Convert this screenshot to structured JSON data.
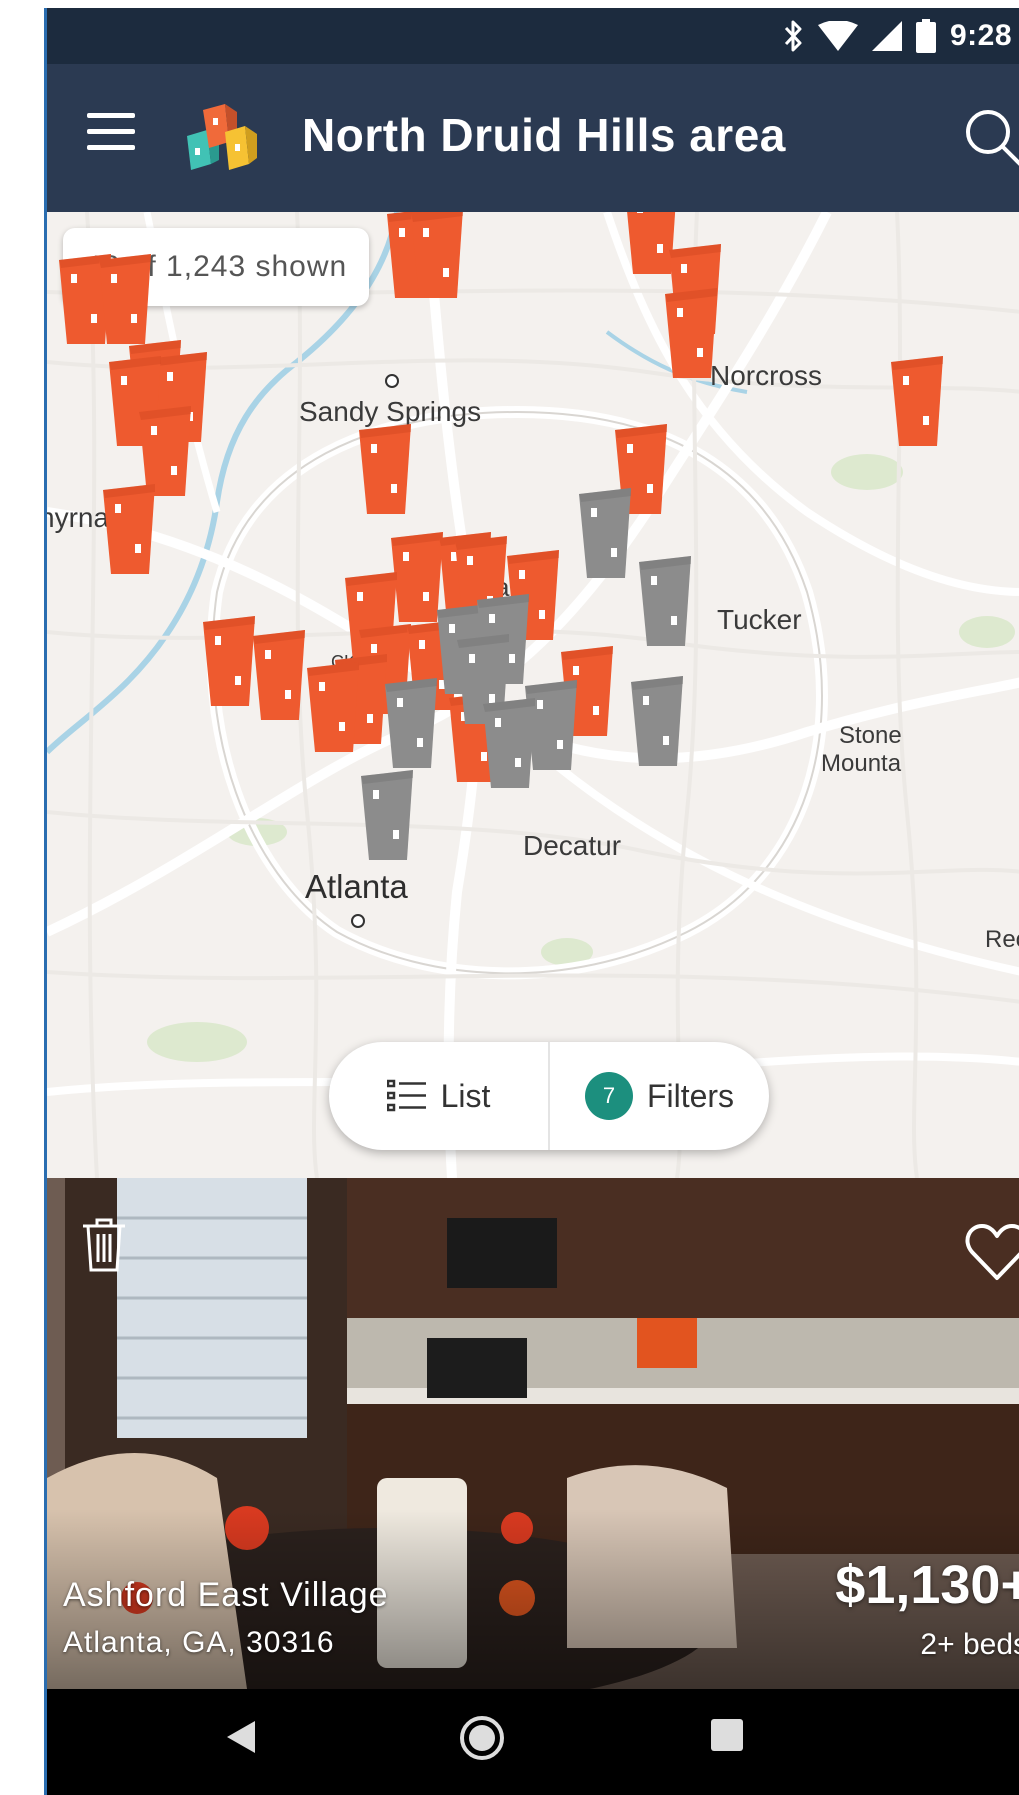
{
  "status_bar": {
    "time": "9:28",
    "icons": [
      "bluetooth-icon",
      "wifi-icon",
      "cell-signal-icon",
      "battery-icon"
    ]
  },
  "app_bar": {
    "title": "North Druid Hills area",
    "menu_icon": "hamburger-menu-icon",
    "logo": "app-logo",
    "search_icon": "search-icon",
    "background": "#2b3a52"
  },
  "map": {
    "results_count": "48 of 1,243 shown",
    "places": {
      "norcross": "Norcross",
      "sandy_springs": "Sandy Springs",
      "smyrna": "nyrna",
      "tucker": "Tucker",
      "stone_mountain_1": "Stone",
      "stone_mountain_2": "Mounta",
      "decatur": "Decatur",
      "atlanta": "Atlanta",
      "red": "Rec",
      "buckhead_partial": "CKH",
      "partial_a": "a"
    },
    "pin_colors": {
      "active": "#ee5a2f",
      "viewed": "#8c8c8c"
    },
    "float_bar": {
      "list_label": "List",
      "filters_label": "Filters",
      "filter_count": "7",
      "badge_color": "#1c8f7e"
    }
  },
  "listing": {
    "name": "Ashford East Village",
    "address": "Atlanta, GA, 30316",
    "price": "$1,130+",
    "beds": "2+ beds"
  },
  "nav_bar": {
    "back_icon": "back-triangle-icon",
    "home_icon": "home-circle-icon",
    "recents_icon": "recents-square-icon"
  }
}
